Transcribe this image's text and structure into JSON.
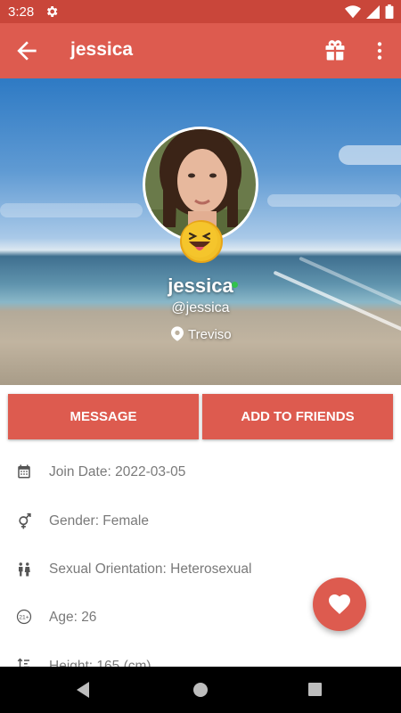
{
  "status_bar": {
    "time": "3:28"
  },
  "app_bar": {
    "title": "jessica"
  },
  "profile": {
    "name": "jessica",
    "handle": "@jessica",
    "location": "Treviso",
    "online": true
  },
  "actions": {
    "message_label": "MESSAGE",
    "add_friends_label": "ADD TO FRIENDS"
  },
  "info_rows": [
    {
      "icon": "calendar-icon",
      "text": "Join Date: 2022-03-05"
    },
    {
      "icon": "gender-icon",
      "text": "Gender: Female"
    },
    {
      "icon": "people-icon",
      "text": "Sexual Orientation: Heterosexual"
    },
    {
      "icon": "age-icon",
      "text": "Age: 26"
    },
    {
      "icon": "height-icon",
      "text": "Height: 165 (cm)"
    }
  ],
  "colors": {
    "accent": "#dd5b4f",
    "status_bar": "#c9463a",
    "online": "#32c24d"
  }
}
